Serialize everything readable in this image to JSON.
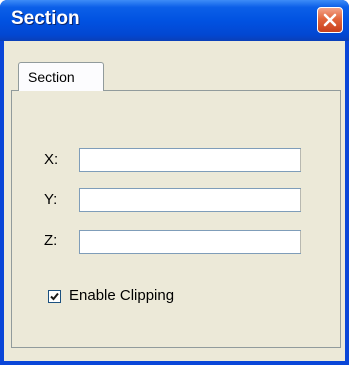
{
  "window": {
    "title": "Section"
  },
  "tabs": [
    {
      "label": "Section",
      "selected": true
    }
  ],
  "fields": [
    {
      "label": "X:",
      "value": "",
      "placeholder": ""
    },
    {
      "label": "Y:",
      "value": "",
      "placeholder": ""
    },
    {
      "label": "Z:",
      "value": "",
      "placeholder": ""
    }
  ],
  "options": {
    "enable_clipping_label": "Enable Clipping",
    "enable_clipping_checked": true
  },
  "colors": {
    "titlebar": "#0152e1",
    "close_button": "#e2663c",
    "face": "#ece9d8"
  },
  "icons": {
    "close": "close-icon",
    "check": "checkmark-icon"
  }
}
